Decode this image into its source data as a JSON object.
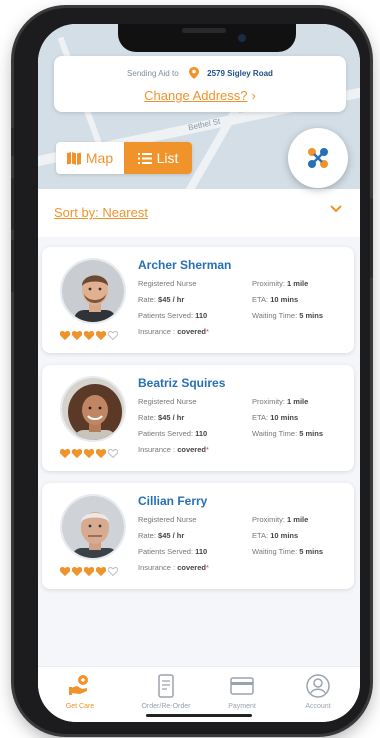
{
  "colors": {
    "accent": "#f0932b",
    "name_blue": "#2670b8",
    "map_bg": "#d3dee6"
  },
  "address": {
    "prefix": "Sending Aid to",
    "street": "2579 Sigley Road",
    "change_label": "Change Address?",
    "change_chevron": "›"
  },
  "map": {
    "road_label": "Bethel St"
  },
  "view_toggle": {
    "map_label": "Map",
    "list_label": "List",
    "selected": "List"
  },
  "sort": {
    "label": "Sort by: Nearest"
  },
  "caregivers": [
    {
      "name": "Archer Sherman",
      "role": "Registered Nurse",
      "rate_label": "Rate:",
      "rate": "$45 / hr",
      "served_label": "Patients Served:",
      "served": "110",
      "insurance_label": "Insurance :",
      "insurance": "covered",
      "insurance_mark": "*",
      "proximity_label": "Proximity:",
      "proximity": "1 mile",
      "eta_label": "ETA:",
      "eta": "10 mins",
      "wait_label": "Waiting Time:",
      "wait": "5 mins",
      "rating": 4,
      "rating_max": 5
    },
    {
      "name": "Beatriz Squires",
      "role": "Registered Nurse",
      "rate_label": "Rate:",
      "rate": "$45 / hr",
      "served_label": "Patients Served:",
      "served": "110",
      "insurance_label": "Insurance :",
      "insurance": "covered",
      "insurance_mark": "*",
      "proximity_label": "Proximity:",
      "proximity": "1 mile",
      "eta_label": "ETA:",
      "eta": "10 mins",
      "wait_label": "Waiting Time:",
      "wait": "5 mins",
      "rating": 4,
      "rating_max": 5
    },
    {
      "name": "Cillian Ferry",
      "role": "Registered Nurse",
      "rate_label": "Rate:",
      "rate": "$45 / hr",
      "served_label": "Patients Served:",
      "served": "110",
      "insurance_label": "Insurance :",
      "insurance": "covered",
      "insurance_mark": "*",
      "proximity_label": "Proximity:",
      "proximity": "1 mile",
      "eta_label": "ETA:",
      "eta": "10 mins",
      "wait_label": "Waiting Time:",
      "wait": "5 mins",
      "rating": 4,
      "rating_max": 5
    }
  ],
  "nav": [
    {
      "label": "Get Care",
      "icon": "care-hand-icon",
      "active": true
    },
    {
      "label": "Order/Re-Order",
      "icon": "order-phone-icon",
      "active": false
    },
    {
      "label": "Payment",
      "icon": "credit-card-icon",
      "active": false
    },
    {
      "label": "Account",
      "icon": "account-icon",
      "active": false
    }
  ]
}
